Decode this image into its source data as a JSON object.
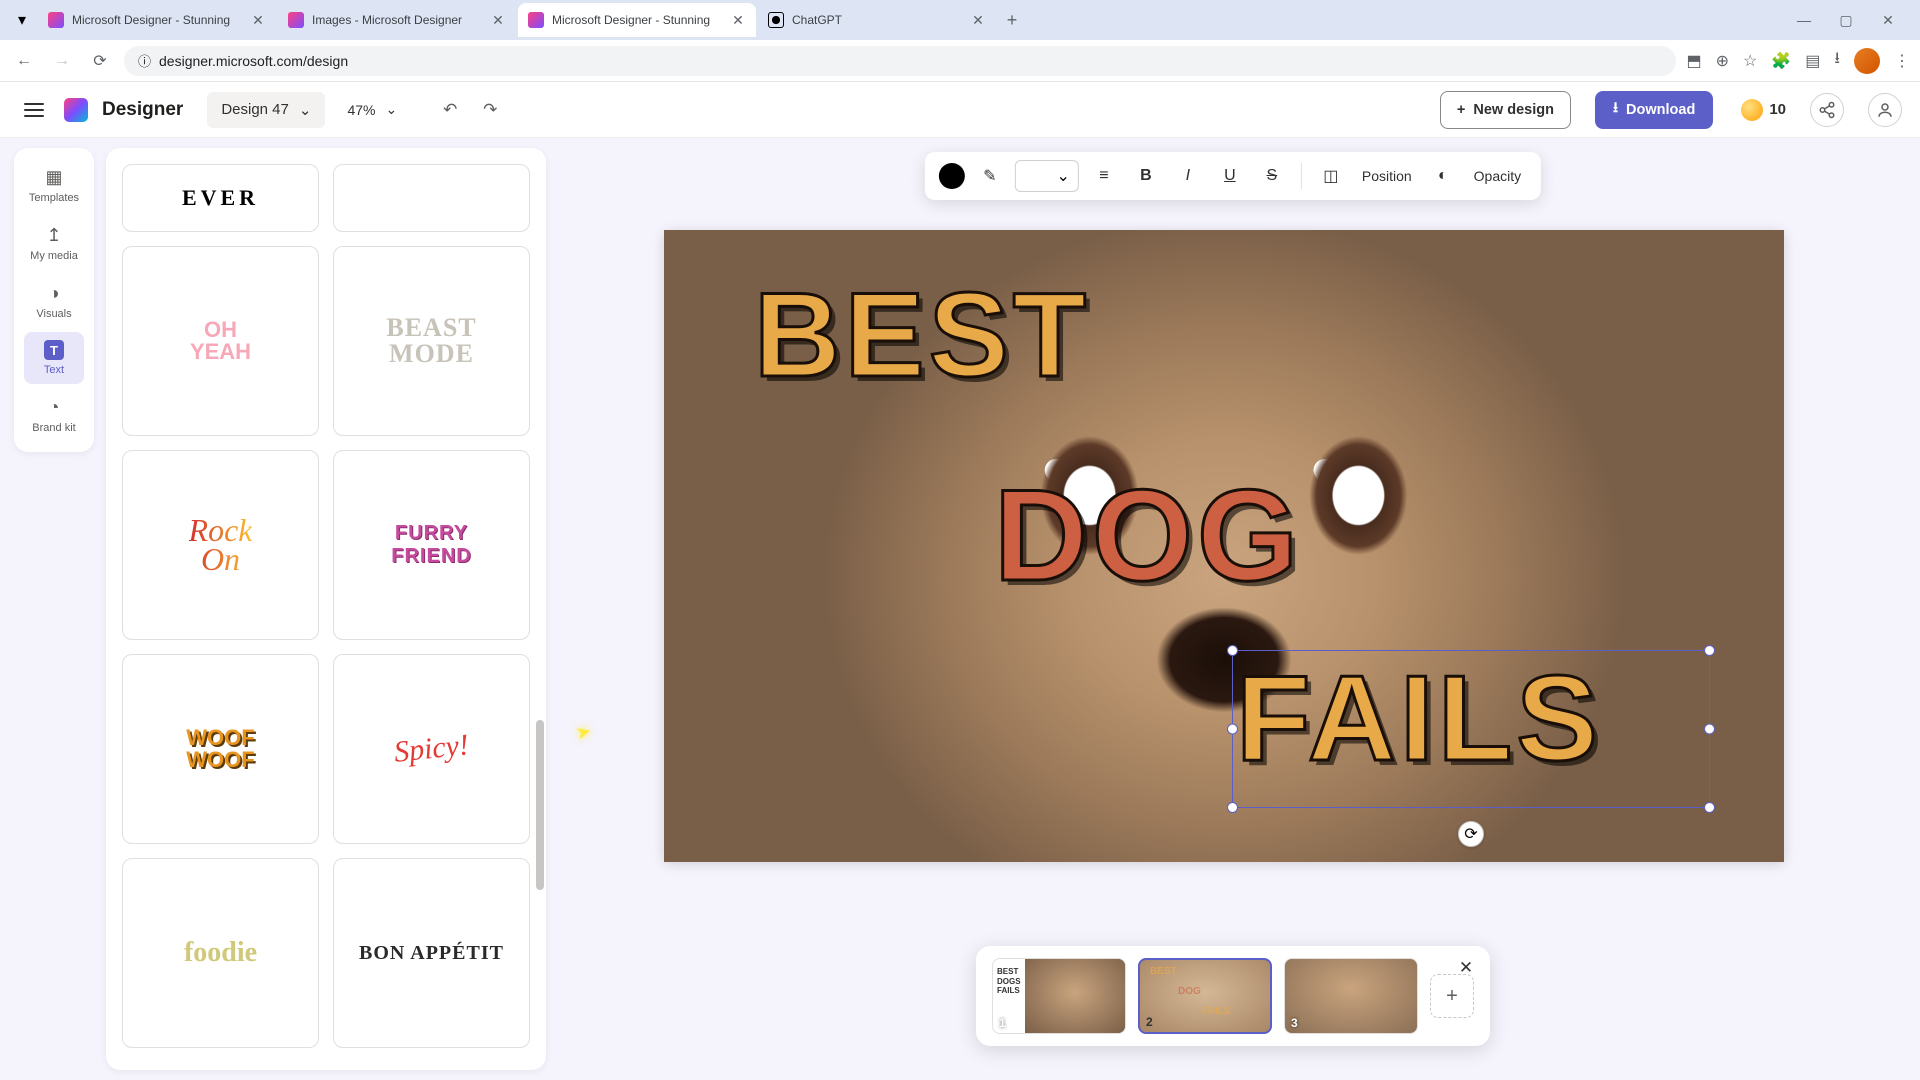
{
  "browser": {
    "tabs": [
      {
        "title": "Microsoft Designer - Stunning",
        "favicon": "designer"
      },
      {
        "title": "Images - Microsoft Designer",
        "favicon": "designer"
      },
      {
        "title": "Microsoft Designer - Stunning",
        "favicon": "designer"
      },
      {
        "title": "ChatGPT",
        "favicon": "chatgpt"
      }
    ],
    "active_tab": 2,
    "url": "designer.microsoft.com/design"
  },
  "header": {
    "app_name": "Designer",
    "design_name": "Design 47",
    "zoom": "47%",
    "new_design_label": "New design",
    "download_label": "Download",
    "coins": "10"
  },
  "side_rail": {
    "items": [
      {
        "label": "Templates",
        "icon": "grid"
      },
      {
        "label": "My media",
        "icon": "upload"
      },
      {
        "label": "Visuals",
        "icon": "shapes"
      },
      {
        "label": "Text",
        "icon": "text"
      },
      {
        "label": "Brand kit",
        "icon": "palette"
      }
    ],
    "active": 3
  },
  "text_styles": [
    {
      "label": "EVER",
      "class": "tc-ever"
    },
    {
      "label": "",
      "class": ""
    },
    {
      "label": "OH\nYEAH",
      "class": "tc-ohyeah"
    },
    {
      "label": "BEAST\nMODE",
      "class": "tc-beast"
    },
    {
      "label": "Rock\nOn",
      "class": "tc-rockon"
    },
    {
      "label": "FURRY\nFRIEND",
      "class": "tc-furry"
    },
    {
      "label": "WOOF\nWOOF",
      "class": "tc-woof"
    },
    {
      "label": "Spicy!",
      "class": "tc-spicy"
    },
    {
      "label": "foodie",
      "class": "tc-foodie"
    },
    {
      "label": "BON APPÉTIT",
      "class": "tc-bon"
    }
  ],
  "toolbar": {
    "position_label": "Position",
    "opacity_label": "Opacity"
  },
  "canvas": {
    "text_best": "BEST",
    "text_dog": "DOG",
    "text_fails": "FAILS"
  },
  "pages": {
    "thumbs": [
      {
        "num": "1",
        "lines": [
          "BEST",
          "DOGS",
          "FAILS"
        ]
      },
      {
        "num": "2"
      },
      {
        "num": "3"
      }
    ],
    "active": 1
  },
  "colors": {
    "accent": "#5b5fc7",
    "text_orange": "#e8a948",
    "text_red": "#cd5f43"
  }
}
